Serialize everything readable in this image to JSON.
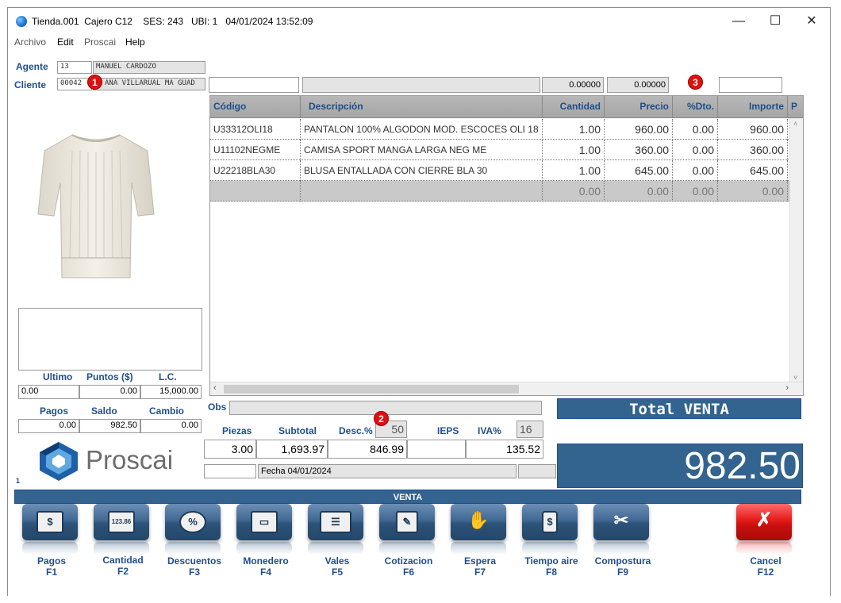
{
  "window": {
    "title": "Tienda.001  Cajero C12    SES: 243   UBI: 1   04/01/2024 13:52:09",
    "minimize": "—",
    "maximize": "☐",
    "close": "✕"
  },
  "menu": [
    "Archivo",
    "Edit",
    "Proscai",
    "Help"
  ],
  "agente": {
    "label": "Agente",
    "code": "13",
    "name": "MANUEL CARDOZO"
  },
  "cliente": {
    "label": "Cliente",
    "code": "00042",
    "name": "ANA VILLARUAL MA GUAD"
  },
  "entry": {
    "qty": "0.00000",
    "price": "0.00000"
  },
  "badges": [
    "1",
    "2",
    "3"
  ],
  "grid": {
    "headers": [
      "Código",
      "Descripción",
      "Cantidad",
      "Precio",
      "%Dto.",
      "Importe",
      "P"
    ],
    "rows": [
      [
        "U33312OLI18",
        "PANTALON 100%  ALGODON MOD. ESCOCES OLI 18",
        "1.00",
        "960.00",
        "0.00",
        "960.00"
      ],
      [
        "U11102NEGME",
        "CAMISA SPORT MANGA LARGA NEG ME",
        "1.00",
        "360.00",
        "0.00",
        "360.00"
      ],
      [
        "U22218BLA30",
        "BLUSA ENTALLADA CON CIERRE BLA 30",
        "1.00",
        "645.00",
        "0.00",
        "645.00"
      ],
      [
        "",
        "",
        "0.00",
        "0.00",
        "0.00",
        "0.00"
      ]
    ]
  },
  "left_stats": {
    "ultimo_label": "Ultimo",
    "puntos_label": "Puntos ($)",
    "lc_label": "L.C.",
    "ultimo": "0.00",
    "puntos": "0.00",
    "lc": "15,000.00",
    "pagos_label": "Pagos",
    "saldo_label": "Saldo",
    "cambio_label": "Cambio",
    "pagos": "0.00",
    "saldo": "982.50",
    "cambio": "0.00"
  },
  "logo": {
    "text": "Proscai"
  },
  "session_no": "1",
  "obs": {
    "label": "Obs",
    "value": ""
  },
  "totals": {
    "piezas_label": "Piezas",
    "subtotal_label": "Subtotal",
    "desc_label": "Desc.%",
    "desc_pct": "50",
    "ieps_label": "IEPS",
    "iva_label": "IVA%",
    "iva_pct": "16",
    "piezas": "3.00",
    "subtotal": "1,693.97",
    "descuento": "846.99",
    "ieps": "",
    "iva": "135.52",
    "fecha": "Fecha 04/01/2024"
  },
  "total_venta": {
    "label": "Total VENTA",
    "value": "982.50"
  },
  "mode_bar": "VENTA",
  "fkeys": [
    {
      "label": "Pagos",
      "key": "F1",
      "icon": "$"
    },
    {
      "label": "Cantidad",
      "key": "F2",
      "icon": "123.86"
    },
    {
      "label": "Descuentos",
      "key": "F3",
      "icon": "%"
    },
    {
      "label": "Monedero",
      "key": "F4",
      "icon": "▭"
    },
    {
      "label": "Vales",
      "key": "F5",
      "icon": "☰"
    },
    {
      "label": "Cotizacion",
      "key": "F6",
      "icon": "✎"
    },
    {
      "label": "Espera",
      "key": "F7",
      "icon": "✋"
    },
    {
      "label": "Tiempo aire",
      "key": "F8",
      "icon": "$"
    },
    {
      "label": "Compostura",
      "key": "F9",
      "icon": "✂"
    },
    {
      "label": "Cancel",
      "key": "F12",
      "icon": "✗"
    }
  ],
  "colors": {
    "accent": "#1f4e8c",
    "panel": "#33638f",
    "cancel": "#e51a1a"
  }
}
